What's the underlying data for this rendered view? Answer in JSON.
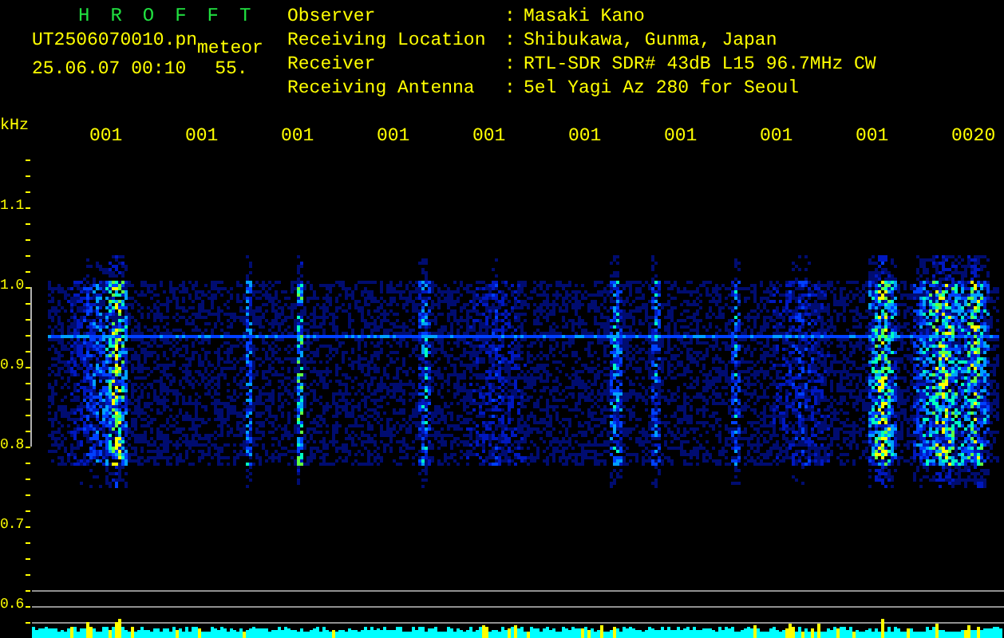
{
  "header": {
    "title": "HROFFT",
    "filename": "UT2506070010.pn",
    "mode": "meteor",
    "datetime": "25.06.07 00:10",
    "value": "55."
  },
  "info": [
    {
      "label": "Observer",
      "separator": ":",
      "value": "Masaki Kano"
    },
    {
      "label": "Receiving Location",
      "separator": ":",
      "value": "Shibukawa, Gunma, Japan"
    },
    {
      "label": "Receiver",
      "separator": ":",
      "value": "RTL-SDR SDR# 43dB L15 96.7MHz CW"
    },
    {
      "label": "Receiving Antenna",
      "separator": ":",
      "value": "5el Yagi Az 280 for Seoul"
    }
  ],
  "plot": {
    "y_unit": "kHz",
    "y_labels": [
      "1.1",
      "1.0",
      "0.9",
      "0.8",
      "0.7",
      "0.6"
    ],
    "time_labels": [
      "001",
      "001",
      "001",
      "001",
      "001",
      "001",
      "001",
      "001",
      "001",
      "0020"
    ]
  }
}
